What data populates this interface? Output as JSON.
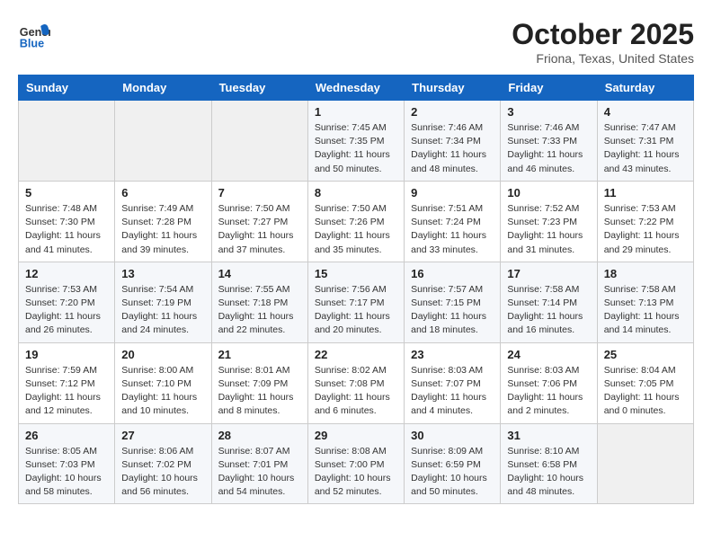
{
  "header": {
    "logo_line1": "General",
    "logo_line2": "Blue",
    "month": "October 2025",
    "location": "Friona, Texas, United States"
  },
  "days_of_week": [
    "Sunday",
    "Monday",
    "Tuesday",
    "Wednesday",
    "Thursday",
    "Friday",
    "Saturday"
  ],
  "weeks": [
    [
      {
        "day": "",
        "info": ""
      },
      {
        "day": "",
        "info": ""
      },
      {
        "day": "",
        "info": ""
      },
      {
        "day": "1",
        "info": "Sunrise: 7:45 AM\nSunset: 7:35 PM\nDaylight: 11 hours and 50 minutes."
      },
      {
        "day": "2",
        "info": "Sunrise: 7:46 AM\nSunset: 7:34 PM\nDaylight: 11 hours and 48 minutes."
      },
      {
        "day": "3",
        "info": "Sunrise: 7:46 AM\nSunset: 7:33 PM\nDaylight: 11 hours and 46 minutes."
      },
      {
        "day": "4",
        "info": "Sunrise: 7:47 AM\nSunset: 7:31 PM\nDaylight: 11 hours and 43 minutes."
      }
    ],
    [
      {
        "day": "5",
        "info": "Sunrise: 7:48 AM\nSunset: 7:30 PM\nDaylight: 11 hours and 41 minutes."
      },
      {
        "day": "6",
        "info": "Sunrise: 7:49 AM\nSunset: 7:28 PM\nDaylight: 11 hours and 39 minutes."
      },
      {
        "day": "7",
        "info": "Sunrise: 7:50 AM\nSunset: 7:27 PM\nDaylight: 11 hours and 37 minutes."
      },
      {
        "day": "8",
        "info": "Sunrise: 7:50 AM\nSunset: 7:26 PM\nDaylight: 11 hours and 35 minutes."
      },
      {
        "day": "9",
        "info": "Sunrise: 7:51 AM\nSunset: 7:24 PM\nDaylight: 11 hours and 33 minutes."
      },
      {
        "day": "10",
        "info": "Sunrise: 7:52 AM\nSunset: 7:23 PM\nDaylight: 11 hours and 31 minutes."
      },
      {
        "day": "11",
        "info": "Sunrise: 7:53 AM\nSunset: 7:22 PM\nDaylight: 11 hours and 29 minutes."
      }
    ],
    [
      {
        "day": "12",
        "info": "Sunrise: 7:53 AM\nSunset: 7:20 PM\nDaylight: 11 hours and 26 minutes."
      },
      {
        "day": "13",
        "info": "Sunrise: 7:54 AM\nSunset: 7:19 PM\nDaylight: 11 hours and 24 minutes."
      },
      {
        "day": "14",
        "info": "Sunrise: 7:55 AM\nSunset: 7:18 PM\nDaylight: 11 hours and 22 minutes."
      },
      {
        "day": "15",
        "info": "Sunrise: 7:56 AM\nSunset: 7:17 PM\nDaylight: 11 hours and 20 minutes."
      },
      {
        "day": "16",
        "info": "Sunrise: 7:57 AM\nSunset: 7:15 PM\nDaylight: 11 hours and 18 minutes."
      },
      {
        "day": "17",
        "info": "Sunrise: 7:58 AM\nSunset: 7:14 PM\nDaylight: 11 hours and 16 minutes."
      },
      {
        "day": "18",
        "info": "Sunrise: 7:58 AM\nSunset: 7:13 PM\nDaylight: 11 hours and 14 minutes."
      }
    ],
    [
      {
        "day": "19",
        "info": "Sunrise: 7:59 AM\nSunset: 7:12 PM\nDaylight: 11 hours and 12 minutes."
      },
      {
        "day": "20",
        "info": "Sunrise: 8:00 AM\nSunset: 7:10 PM\nDaylight: 11 hours and 10 minutes."
      },
      {
        "day": "21",
        "info": "Sunrise: 8:01 AM\nSunset: 7:09 PM\nDaylight: 11 hours and 8 minutes."
      },
      {
        "day": "22",
        "info": "Sunrise: 8:02 AM\nSunset: 7:08 PM\nDaylight: 11 hours and 6 minutes."
      },
      {
        "day": "23",
        "info": "Sunrise: 8:03 AM\nSunset: 7:07 PM\nDaylight: 11 hours and 4 minutes."
      },
      {
        "day": "24",
        "info": "Sunrise: 8:03 AM\nSunset: 7:06 PM\nDaylight: 11 hours and 2 minutes."
      },
      {
        "day": "25",
        "info": "Sunrise: 8:04 AM\nSunset: 7:05 PM\nDaylight: 11 hours and 0 minutes."
      }
    ],
    [
      {
        "day": "26",
        "info": "Sunrise: 8:05 AM\nSunset: 7:03 PM\nDaylight: 10 hours and 58 minutes."
      },
      {
        "day": "27",
        "info": "Sunrise: 8:06 AM\nSunset: 7:02 PM\nDaylight: 10 hours and 56 minutes."
      },
      {
        "day": "28",
        "info": "Sunrise: 8:07 AM\nSunset: 7:01 PM\nDaylight: 10 hours and 54 minutes."
      },
      {
        "day": "29",
        "info": "Sunrise: 8:08 AM\nSunset: 7:00 PM\nDaylight: 10 hours and 52 minutes."
      },
      {
        "day": "30",
        "info": "Sunrise: 8:09 AM\nSunset: 6:59 PM\nDaylight: 10 hours and 50 minutes."
      },
      {
        "day": "31",
        "info": "Sunrise: 8:10 AM\nSunset: 6:58 PM\nDaylight: 10 hours and 48 minutes."
      },
      {
        "day": "",
        "info": ""
      }
    ]
  ]
}
